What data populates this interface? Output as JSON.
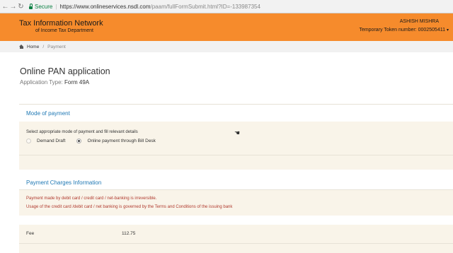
{
  "browser": {
    "secure_label": "Secure",
    "url_host": "https://www.onlineservices.nsdl.com",
    "url_path": "/paam/fullFormSubmit.html?ID=-133987354"
  },
  "header": {
    "title_line1": "Tax Information Network",
    "title_line2": "of Income Tax Department",
    "user_name": "ASHISH MISHRA",
    "token_label": "Temporary Token number: 0002505411"
  },
  "breadcrumb": {
    "home": "Home",
    "separator": "/",
    "current": "Payment"
  },
  "page": {
    "title": "Online PAN application",
    "app_type_label": "Application Type:",
    "app_type_value": "Form 49A"
  },
  "mode_of_payment": {
    "heading": "Mode of payment",
    "instruction": "Select appropriate mode of payment and fill relevant details",
    "options": [
      {
        "label": "Demand Draft",
        "selected": false
      },
      {
        "label": "Online payment through Bill Desk",
        "selected": true
      }
    ]
  },
  "payment_charges": {
    "heading": "Payment Charges Information",
    "notice_line1": "Payment made by debit card / credit card / net-banking is irreversible.",
    "notice_line2": "Usage of the credit card /debit card / net banking is governed by the Terms and Conditions of the issuing bank",
    "fee_label": "Fee",
    "fee_value": "112.75"
  },
  "colors": {
    "header_orange": "#f68b2c",
    "section_blue": "#1f78b4",
    "notice_red": "#b03a2e",
    "panel_beige": "#f9f4e9"
  }
}
